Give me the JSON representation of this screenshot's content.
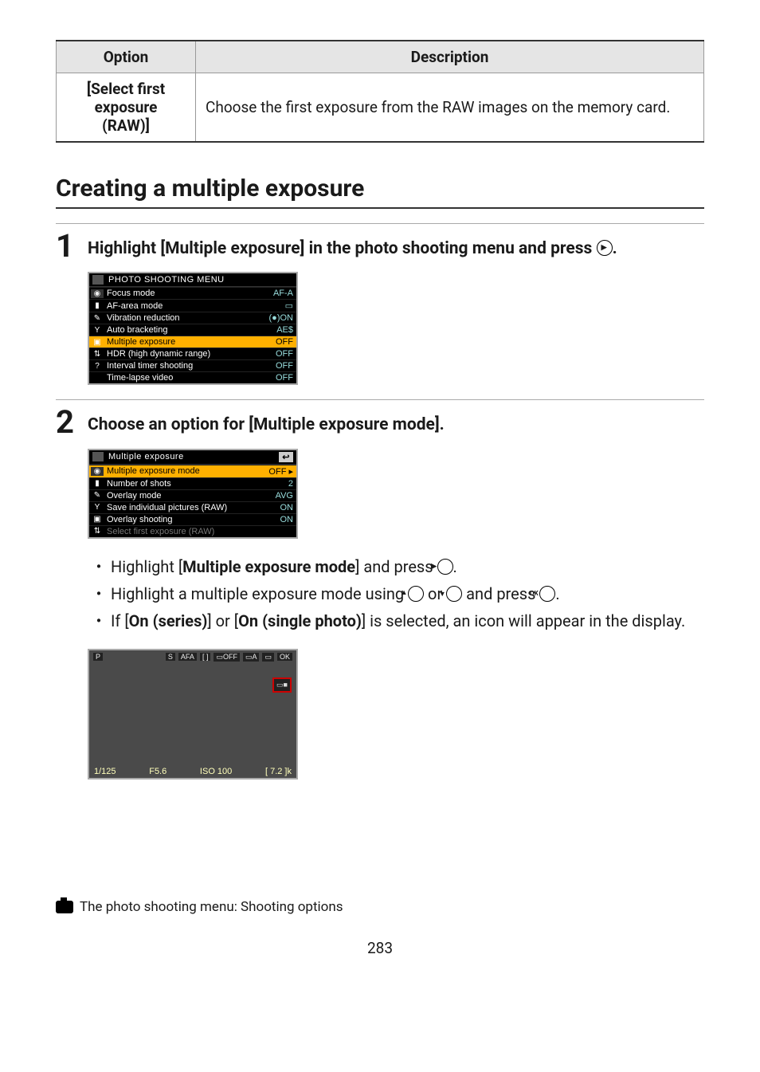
{
  "table": {
    "headers": {
      "option": "Option",
      "description": "Description"
    },
    "row": {
      "option_line1": "[Select first",
      "option_line2": "exposure",
      "option_line3": "(RAW)]",
      "description": "Choose the first exposure from the RAW images on the memory card."
    }
  },
  "section_title": "Creating a multiple exposure",
  "step1": {
    "num": "1",
    "title_a": "Highlight [Multiple exposure] in the photo shooting menu and press ",
    "title_b": ".",
    "menu": {
      "header": "PHOTO SHOOTING MENU",
      "rows": [
        {
          "label": "Focus mode",
          "val": "AF-A"
        },
        {
          "label": "AF-area mode",
          "val": "▭"
        },
        {
          "label": "Vibration reduction",
          "val": "(●)ON"
        },
        {
          "label": "Auto bracketing",
          "val": "AE$"
        },
        {
          "label": "Multiple exposure",
          "val": "OFF",
          "hl": true
        },
        {
          "label": "HDR (high dynamic range)",
          "val": "OFF"
        },
        {
          "label": "Interval timer shooting",
          "val": "OFF"
        },
        {
          "label": "Time-lapse video",
          "val": "OFF"
        }
      ]
    }
  },
  "step2": {
    "num": "2",
    "title": "Choose an option for [Multiple exposure mode].",
    "menu": {
      "header": "Multiple exposure",
      "back": "↩",
      "rows": [
        {
          "label": "Multiple exposure mode",
          "val": "OFF ▸",
          "hl": true
        },
        {
          "label": "Number of shots",
          "val": "2"
        },
        {
          "label": "Overlay mode",
          "val": "AVG"
        },
        {
          "label": "Save individual pictures (RAW)",
          "val": "ON"
        },
        {
          "label": "Overlay shooting",
          "val": "ON"
        },
        {
          "label": "Select first exposure (RAW)",
          "val": "",
          "dim": true
        }
      ]
    },
    "bullets": {
      "b1a": "Highlight [",
      "b1b": "Multiple exposure mode",
      "b1c": "] and press ",
      "b1d": ".",
      "b2a": "Highlight a multiple exposure mode using ",
      "b2b": " or ",
      "b2c": " and press ",
      "b2d": ".",
      "b3a": "If [",
      "b3b": "On (series)",
      "b3c": "] or [",
      "b3d": "On (single photo)",
      "b3e": "] is selected, an icon will appear in the display."
    },
    "lcd": {
      "mode": "P",
      "chips": [
        "S",
        "AFA",
        "[ ]",
        "▭OFF",
        "▭A",
        "▭",
        "OK"
      ],
      "highlight": "▭■",
      "bottom": {
        "shutter": "1/125",
        "fnum": "F5.6",
        "iso": "ISO 100",
        "shots": "[ 7.2 ]k"
      }
    }
  },
  "footer": "The photo shooting menu: Shooting options",
  "page_number": "283"
}
